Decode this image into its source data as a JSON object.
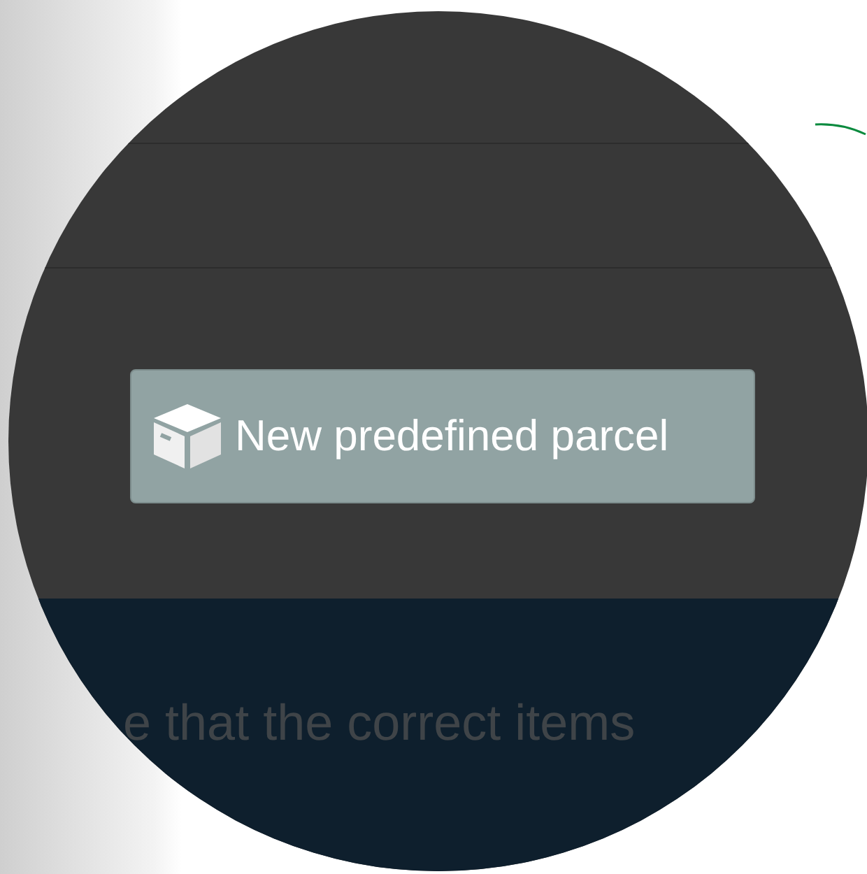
{
  "button": {
    "label": "New predefined parcel"
  },
  "body_text": "e that the correct items"
}
